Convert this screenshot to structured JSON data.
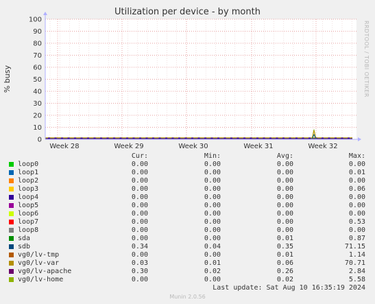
{
  "title": "Utilization per device - by month",
  "side_label": "RRDTOOL / TOBI OETIKER",
  "ylabel": "% busy",
  "chart_data": {
    "type": "line",
    "title": "Utilization per device - by month",
    "ylabel": "% busy",
    "ylim": [
      0,
      100
    ],
    "yticks": [
      0,
      10,
      20,
      30,
      40,
      50,
      60,
      70,
      80,
      90,
      100
    ],
    "xlabels": [
      "Week 28",
      "Week 29",
      "Week 30",
      "Week 31",
      "Week 32"
    ],
    "series": [
      {
        "name": "sdb",
        "color": "#005b7f",
        "peak": 71.15,
        "avg": 0.35
      },
      {
        "name": "vg0/lv-var",
        "color": "#c09700",
        "peak": 70.71,
        "avg": 0.06
      },
      {
        "name": "vg0/lv-home",
        "color": "#8fba2f",
        "peak": 5.58,
        "avg": 0.02
      },
      {
        "name": "vg0/lv-apache",
        "color": "#740075",
        "peak": 2.84,
        "avg": 0.26
      }
    ],
    "grid": true
  },
  "legend": {
    "headers": [
      "Cur:",
      "Min:",
      "Avg:",
      "Max:"
    ],
    "rows": [
      {
        "name": "loop0",
        "color": "#00cc00",
        "cur": "0.00",
        "min": "0.00",
        "avg": "0.00",
        "max": "0.00"
      },
      {
        "name": "loop1",
        "color": "#0066b3",
        "cur": "0.00",
        "min": "0.00",
        "avg": "0.00",
        "max": "0.01"
      },
      {
        "name": "loop2",
        "color": "#ff8000",
        "cur": "0.00",
        "min": "0.00",
        "avg": "0.00",
        "max": "0.00"
      },
      {
        "name": "loop3",
        "color": "#ffcc00",
        "cur": "0.00",
        "min": "0.00",
        "avg": "0.00",
        "max": "0.06"
      },
      {
        "name": "loop4",
        "color": "#330099",
        "cur": "0.00",
        "min": "0.00",
        "avg": "0.00",
        "max": "0.00"
      },
      {
        "name": "loop5",
        "color": "#990099",
        "cur": "0.00",
        "min": "0.00",
        "avg": "0.00",
        "max": "0.00"
      },
      {
        "name": "loop6",
        "color": "#ccff00",
        "cur": "0.00",
        "min": "0.00",
        "avg": "0.00",
        "max": "0.00"
      },
      {
        "name": "loop7",
        "color": "#ff0000",
        "cur": "0.00",
        "min": "0.00",
        "avg": "0.00",
        "max": "0.53"
      },
      {
        "name": "loop8",
        "color": "#808080",
        "cur": "0.00",
        "min": "0.00",
        "avg": "0.00",
        "max": "0.00"
      },
      {
        "name": "sda",
        "color": "#008f00",
        "cur": "0.00",
        "min": "0.00",
        "avg": "0.01",
        "max": "0.87"
      },
      {
        "name": "sdb",
        "color": "#00487d",
        "cur": "0.34",
        "min": "0.04",
        "avg": "0.35",
        "max": "71.15"
      },
      {
        "name": "vg0/lv-tmp",
        "color": "#b35a00",
        "cur": "0.00",
        "min": "0.00",
        "avg": "0.01",
        "max": "1.14"
      },
      {
        "name": "vg0/lv-var",
        "color": "#b38f00",
        "cur": "0.03",
        "min": "0.01",
        "avg": "0.06",
        "max": "70.71"
      },
      {
        "name": "vg0/lv-apache",
        "color": "#6b006b",
        "cur": "0.30",
        "min": "0.02",
        "avg": "0.26",
        "max": "2.84"
      },
      {
        "name": "vg0/lv-home",
        "color": "#8fb300",
        "cur": "0.00",
        "min": "0.00",
        "avg": "0.02",
        "max": "5.58"
      }
    ]
  },
  "last_update": "Last update: Sat Aug 10 16:35:19 2024",
  "footer": "Munin 2.0.56"
}
